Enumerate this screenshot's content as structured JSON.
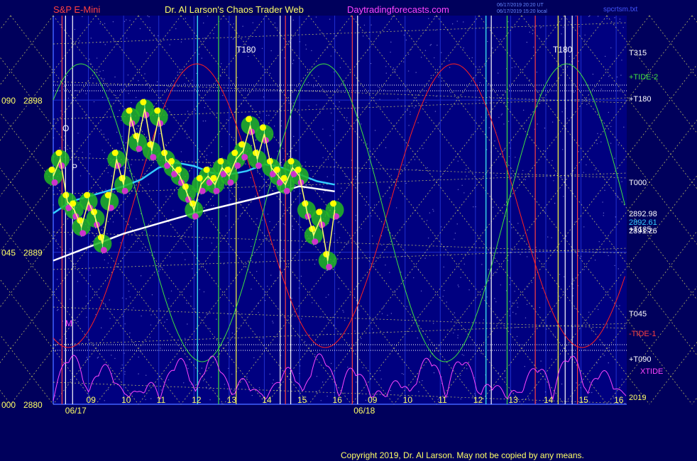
{
  "header": {
    "symbol": "S&P E-Mini",
    "title": "Dr. Al Larson's Chaos Trader Web",
    "site": "Daytradingforecasts.com",
    "stamp_line1": "06/17/2019 20:20 UT",
    "stamp_line2": "06/17/2019 15:20 local",
    "file": "spcrtsm.txt"
  },
  "footer": {
    "copyright": "Copyright 2019, Dr. Al Larson. May not be copied by any means."
  },
  "colors": {
    "background": "#00005c",
    "plot_background": "#000080",
    "price": "#ffff66",
    "price_glow": "#22b822",
    "white_ma": "#ffffff",
    "cyan_ma": "#33ccff",
    "red_line": "#ff2020",
    "green_line": "#40e040",
    "xtide": "#ff44ff",
    "grid_diag": "#ffff66"
  },
  "chart_data": {
    "type": "line",
    "title": "S&P E-Mini",
    "ylim": [
      2880,
      2903
    ],
    "y_ticks": [
      {
        "value": 2898,
        "label": "2898",
        "prefix": "090"
      },
      {
        "value": 2889,
        "label": "2889",
        "prefix": "045"
      },
      {
        "value": 2880,
        "label": "2880",
        "prefix": "000"
      }
    ],
    "x_labels": [
      {
        "t": 0.5,
        "label": "06/17"
      },
      {
        "t": 1.1,
        "label": "09"
      },
      {
        "t": 2.1,
        "label": "10"
      },
      {
        "t": 3.1,
        "label": "11"
      },
      {
        "t": 4.1,
        "label": "12"
      },
      {
        "t": 5.1,
        "label": "13"
      },
      {
        "t": 6.1,
        "label": "14"
      },
      {
        "t": 7.1,
        "label": "15"
      },
      {
        "t": 8.1,
        "label": "16"
      },
      {
        "t": 8.7,
        "label": "06/18"
      },
      {
        "t": 9.1,
        "label": "09"
      },
      {
        "t": 10.1,
        "label": "10"
      },
      {
        "t": 11.1,
        "label": "11"
      },
      {
        "t": 12.1,
        "label": "12"
      },
      {
        "t": 13.1,
        "label": "13"
      },
      {
        "t": 14.1,
        "label": "14"
      },
      {
        "t": 15.1,
        "label": "15"
      },
      {
        "t": 16.1,
        "label": "16"
      }
    ],
    "xlim": [
      0,
      16.3
    ],
    "price_series": {
      "t": [
        0,
        0.2,
        0.4,
        0.6,
        0.8,
        1.0,
        1.2,
        1.4,
        1.6,
        1.8,
        2.0,
        2.2,
        2.4,
        2.6,
        2.8,
        3.0,
        3.2,
        3.4,
        3.6,
        3.8,
        4.0,
        4.2,
        4.4,
        4.6,
        4.8,
        5.0,
        5.2,
        5.4,
        5.6,
        5.8,
        6.0,
        6.2,
        6.4,
        6.6,
        6.8,
        7.0,
        7.2,
        7.4,
        7.6,
        7.8,
        8.0
      ],
      "values": [
        2893.5,
        2894.5,
        2892.0,
        2891.5,
        2890.5,
        2892.0,
        2891.0,
        2889.5,
        2892.0,
        2894.5,
        2893.0,
        2897.0,
        2895.5,
        2897.5,
        2895.0,
        2897.0,
        2894.5,
        2894.0,
        2893.5,
        2892.5,
        2891.5,
        2893.0,
        2893.5,
        2893.0,
        2894.0,
        2893.5,
        2894.5,
        2895.0,
        2896.5,
        2894.5,
        2896.0,
        2894.0,
        2893.5,
        2893.0,
        2894.0,
        2893.5,
        2891.5,
        2890.0,
        2891.0,
        2888.5,
        2891.5
      ]
    },
    "series": [
      {
        "color": "#ffffff",
        "t": [
          0,
          1,
          2,
          3,
          4,
          5,
          6,
          7,
          8
        ],
        "values": [
          2888.5,
          2889.3,
          2890.1,
          2890.7,
          2891.3,
          2891.8,
          2892.3,
          2892.9,
          2892.6
        ]
      },
      {
        "color": "#33ccff",
        "t": [
          0,
          0.5,
          1,
          1.5,
          2,
          2.5,
          3,
          3.5,
          4,
          4.5,
          5,
          5.5,
          6,
          6.5,
          7,
          7.5,
          8
        ],
        "values": [
          2891.3,
          2892.0,
          2892.3,
          2892.6,
          2892.9,
          2893.3,
          2894.0,
          2894.3,
          2894.1,
          2893.7,
          2893.6,
          2893.8,
          2894.2,
          2894.0,
          2893.6,
          2893.2,
          2893.0
        ]
      }
    ],
    "right_values": [
      "2892.98",
      "2892.61",
      "2891.26"
    ],
    "right_labels": [
      "T315",
      "+TIDE-2",
      "+T180",
      "T000",
      "+T135",
      "T045",
      "-TIDE-1",
      "+T090",
      "XTIDE",
      "2019"
    ],
    "markers_left": [
      "O",
      "P",
      "M"
    ],
    "top_labels": [
      "T180",
      "T180"
    ]
  }
}
